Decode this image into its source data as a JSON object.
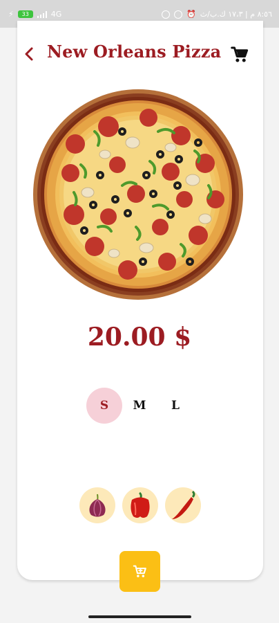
{
  "status_bar": {
    "left_text": "4G",
    "battery": "33",
    "right_text": "٨:٥٦ م | ١٧،٣ ك.ب/ث"
  },
  "header": {
    "title": "New Orleans Pizza",
    "back_icon": "chevron-left-icon",
    "cart_icon": "shopping-cart-icon"
  },
  "product": {
    "image": "pizza-image",
    "price": "20.00 $"
  },
  "sizes": {
    "options": [
      "S",
      "M",
      "L"
    ],
    "selected": "S"
  },
  "toppings": [
    "onion-icon",
    "bell-pepper-icon",
    "chili-pepper-icon"
  ],
  "actions": {
    "add_to_cart_icon": "add-cart-icon",
    "accent_color": "#fbbf15",
    "brand_color": "#9c1c22",
    "selected_size_bg": "#f6d0d8"
  }
}
